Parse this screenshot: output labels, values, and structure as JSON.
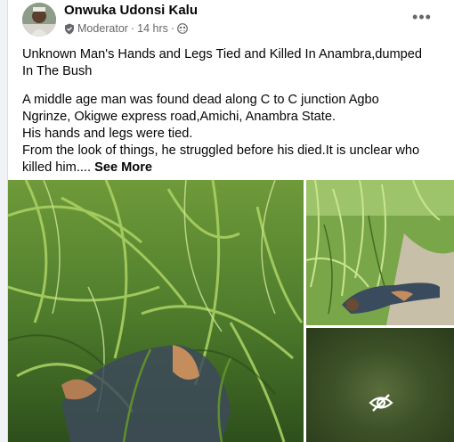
{
  "post": {
    "author": "Onwuka Udonsi Kalu",
    "role": "Moderator",
    "separator": "·",
    "time": "14 hrs",
    "audience_icon": "group-icon",
    "more_label": "•••",
    "headline_line1": "Unknown Man's Hands and Legs Tied and Killed In Anambra,dumped",
    "headline_line2": "In The Bush",
    "body_lines": [
      "A middle age man was found dead along C to C junction Agbo",
      "Ngrinze, Okigwe express road,Amichi, Anambra State.",
      "His hands and legs were tied.",
      "From the look of things, he struggled before his died.It is unclear who",
      "killed him.... "
    ],
    "see_more": "See More"
  },
  "colors": {
    "author_text": "#050505",
    "meta_text": "#65676b",
    "grass_dark": "#2f5a1e",
    "grass_light": "#8dbf4a"
  }
}
